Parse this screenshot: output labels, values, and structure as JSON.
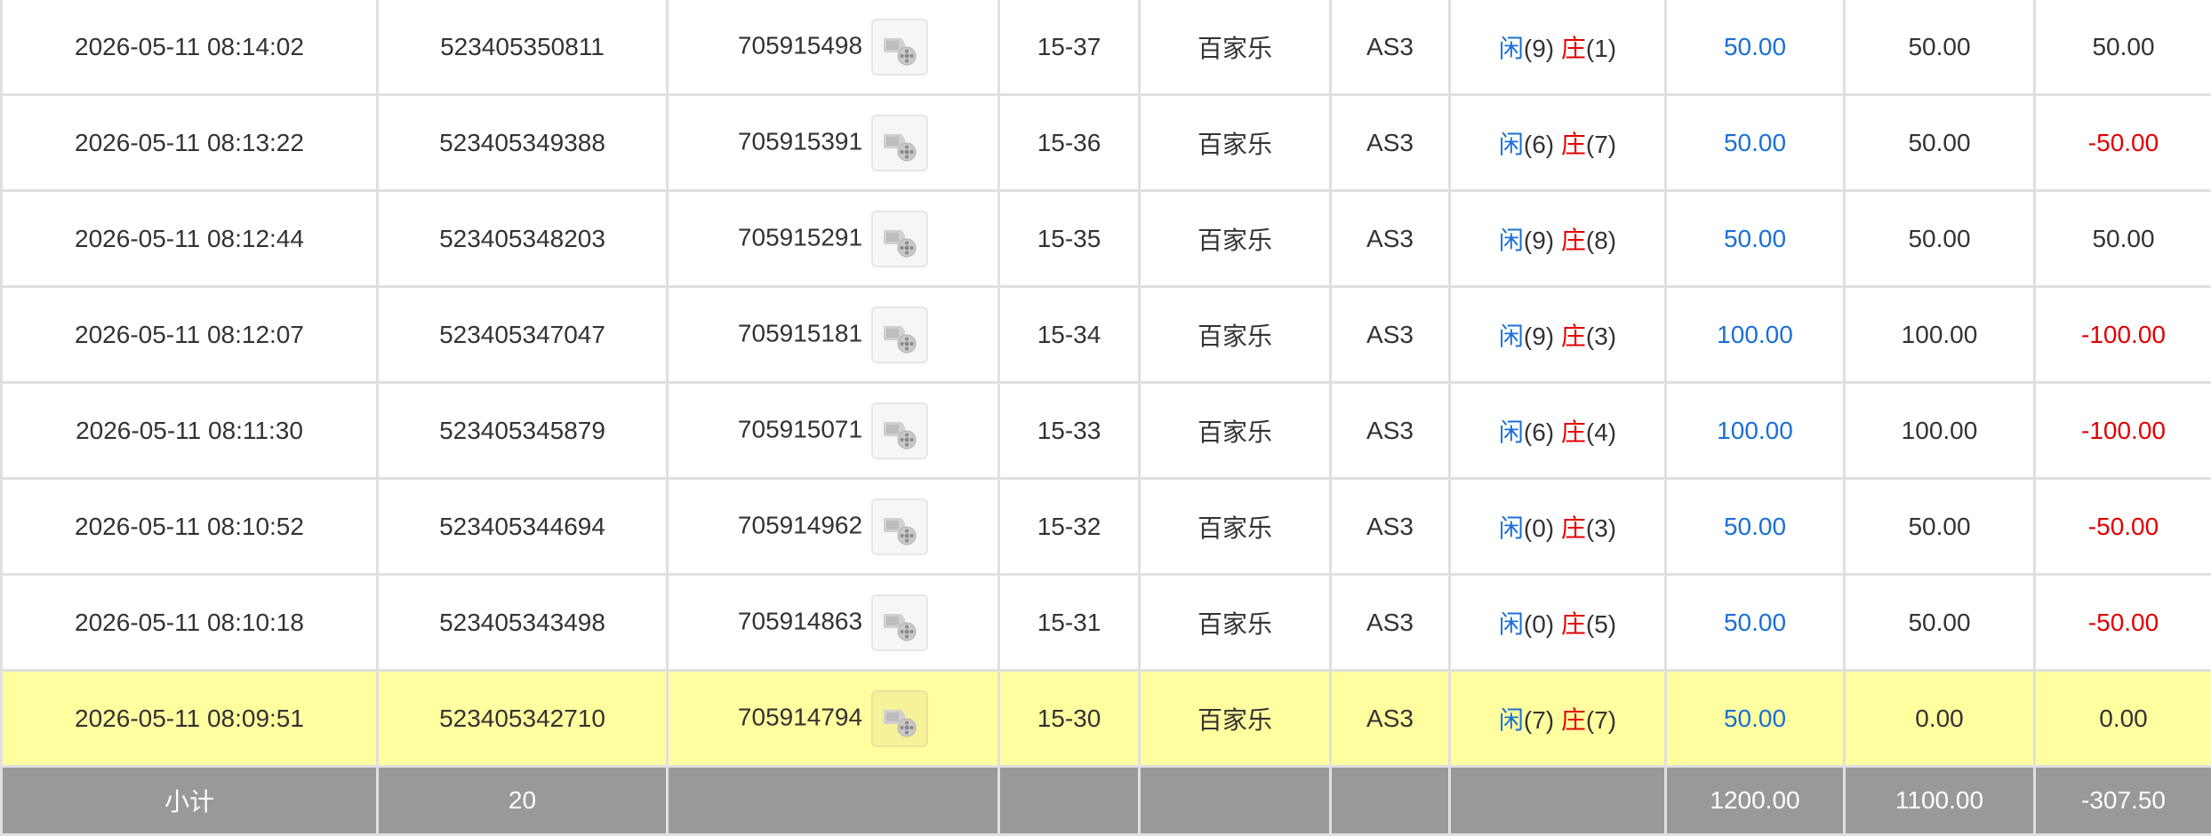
{
  "rows": [
    {
      "time": "2026-05-11 08:14:02",
      "order_no": "523405350811",
      "game_no": "705915498",
      "shoe": "15-37",
      "game": "百家乐",
      "table": "AS3",
      "p_label": "闲",
      "p_val": "(9)",
      "b_label": "庄",
      "b_val": "(1)",
      "bet": "50.00",
      "valid": "50.00",
      "result": "50.00",
      "result_color": "#333333"
    },
    {
      "time": "2026-05-11 08:13:22",
      "order_no": "523405349388",
      "game_no": "705915391",
      "shoe": "15-36",
      "game": "百家乐",
      "table": "AS3",
      "p_label": "闲",
      "p_val": "(6)",
      "b_label": "庄",
      "b_val": "(7)",
      "bet": "50.00",
      "valid": "50.00",
      "result": "-50.00",
      "result_color": "#e00000"
    },
    {
      "time": "2026-05-11 08:12:44",
      "order_no": "523405348203",
      "game_no": "705915291",
      "shoe": "15-35",
      "game": "百家乐",
      "table": "AS3",
      "p_label": "闲",
      "p_val": "(9)",
      "b_label": "庄",
      "b_val": "(8)",
      "bet": "50.00",
      "valid": "50.00",
      "result": "50.00",
      "result_color": "#333333"
    },
    {
      "time": "2026-05-11 08:12:07",
      "order_no": "523405347047",
      "game_no": "705915181",
      "shoe": "15-34",
      "game": "百家乐",
      "table": "AS3",
      "p_label": "闲",
      "p_val": "(9)",
      "b_label": "庄",
      "b_val": "(3)",
      "bet": "100.00",
      "valid": "100.00",
      "result": "-100.00",
      "result_color": "#e00000"
    },
    {
      "time": "2026-05-11 08:11:30",
      "order_no": "523405345879",
      "game_no": "705915071",
      "shoe": "15-33",
      "game": "百家乐",
      "table": "AS3",
      "p_label": "闲",
      "p_val": "(6)",
      "b_label": "庄",
      "b_val": "(4)",
      "bet": "100.00",
      "valid": "100.00",
      "result": "-100.00",
      "result_color": "#e00000"
    },
    {
      "time": "2026-05-11 08:10:52",
      "order_no": "523405344694",
      "game_no": "705914962",
      "shoe": "15-32",
      "game": "百家乐",
      "table": "AS3",
      "p_label": "闲",
      "p_val": "(0)",
      "b_label": "庄",
      "b_val": "(3)",
      "bet": "50.00",
      "valid": "50.00",
      "result": "-50.00",
      "result_color": "#e00000"
    },
    {
      "time": "2026-05-11 08:10:18",
      "order_no": "523405343498",
      "game_no": "705914863",
      "shoe": "15-31",
      "game": "百家乐",
      "table": "AS3",
      "p_label": "闲",
      "p_val": "(0)",
      "b_label": "庄",
      "b_val": "(5)",
      "bet": "50.00",
      "valid": "50.00",
      "result": "-50.00",
      "result_color": "#e00000"
    },
    {
      "time": "2026-05-11 08:09:51",
      "order_no": "523405342710",
      "game_no": "705914794",
      "shoe": "15-30",
      "game": "百家乐",
      "table": "AS3",
      "p_label": "闲",
      "p_val": "(7)",
      "b_label": "庄",
      "b_val": "(7)",
      "bet": "50.00",
      "valid": "0.00",
      "result": "0.00",
      "result_color": "#333333",
      "highlight": true
    }
  ],
  "subtotal": {
    "label": "小计",
    "count": "20",
    "bet_total": "1200.00",
    "valid_total": "1100.00",
    "result_total": "-307.50"
  },
  "icons": {
    "replay": "video-replay-icon"
  },
  "colors": {
    "player": "#1a6fd6",
    "banker": "#e00000",
    "loss": "#e00000",
    "highlight": "#ffffa0",
    "subtotal_bg": "#999999"
  }
}
